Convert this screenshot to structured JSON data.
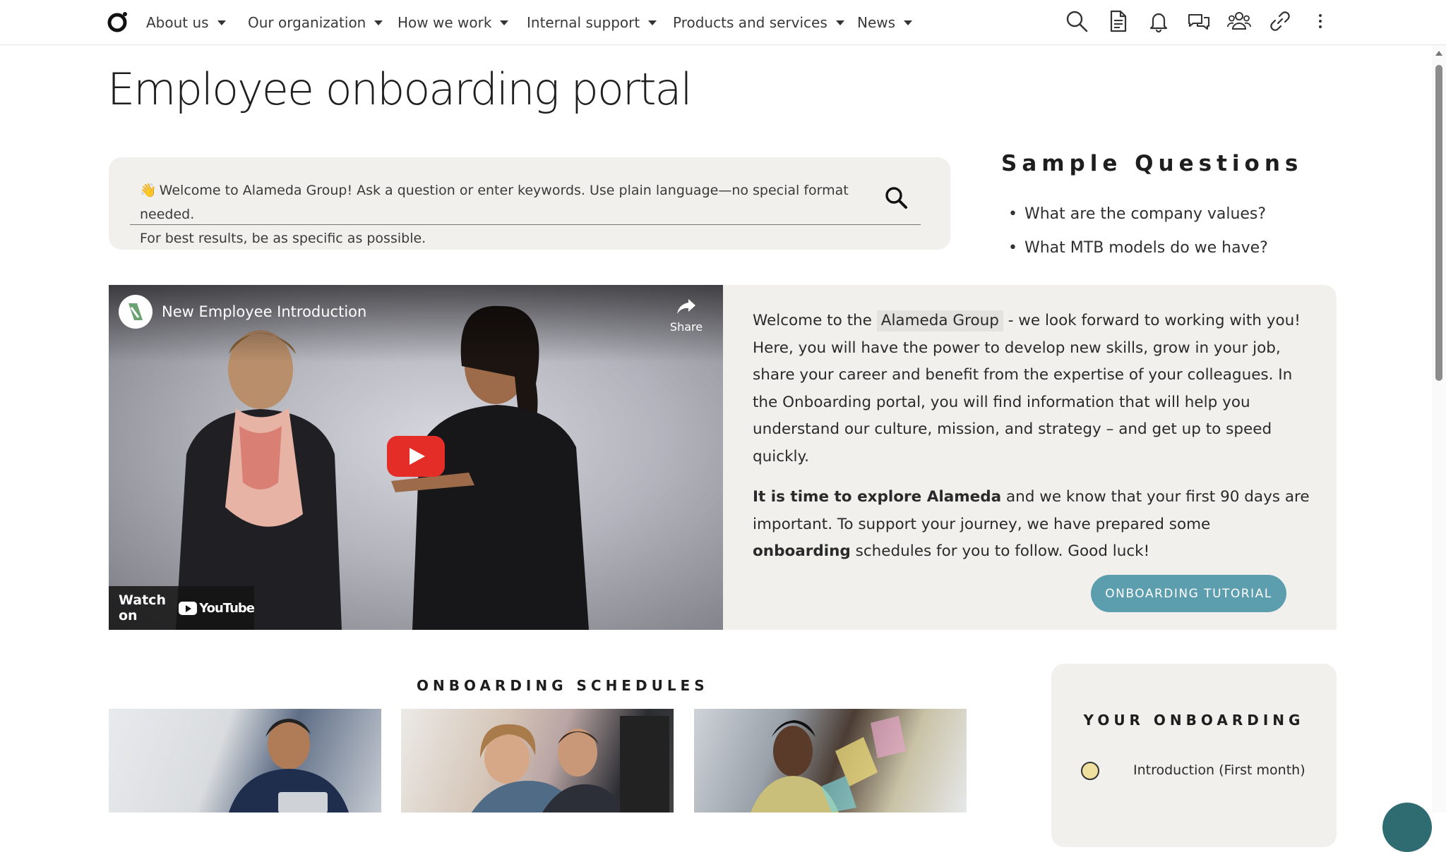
{
  "nav": {
    "items": [
      {
        "label": "About us"
      },
      {
        "label": "Our organization"
      },
      {
        "label": "How we work"
      },
      {
        "label": "Internal support"
      },
      {
        "label": "Products and services"
      },
      {
        "label": "News"
      }
    ],
    "tools": [
      "search-icon",
      "document-icon",
      "bell-icon",
      "chat-icon",
      "people-icon",
      "link-icon",
      "more-icon"
    ]
  },
  "page": {
    "title": "Employee onboarding portal"
  },
  "search": {
    "prompt_line1": "Welcome to Alameda Group! Ask a question or enter keywords. Use plain language—no special format needed.",
    "prompt_line2": "For best results, be as specific as possible.",
    "emoji": "👋"
  },
  "sample_questions": {
    "title": "Sample Questions",
    "items": [
      "What are the company values?",
      "What MTB models do we have?"
    ]
  },
  "video": {
    "title": "New Employee Introduction",
    "share_label": "Share",
    "watch_on": "Watch on",
    "platform": "YouTube"
  },
  "welcome": {
    "p1_before": "Welcome to the",
    "p1_chip": "Alameda Group",
    "p1_after": "- we look forward to working with you! Here, you will have the power to develop new skills, grow in your job, share your career and benefit from the expertise of your colleagues. In the Onboarding portal, you will find information that will help you understand our culture, mission, and strategy – and get up to speed quickly.",
    "p2_bold": "It is time to explore Alameda",
    "p2_mid": "and we know that your first 90 days are important. To support your journey, we have prepared some",
    "p2_bold2": "onboarding",
    "p2_end": "schedules for you to follow. Good luck!",
    "button": "ONBOARDING TUTORIAL"
  },
  "schedules": {
    "title": "ONBOARDING SCHEDULES"
  },
  "your_onboarding": {
    "title": "YOUR ONBOARDING",
    "steps": [
      {
        "label": "Introduction (First month)"
      }
    ]
  },
  "colors": {
    "accent": "#5c9eae",
    "panel": "#f1f0ed",
    "step_dot": "#efe0a0"
  }
}
